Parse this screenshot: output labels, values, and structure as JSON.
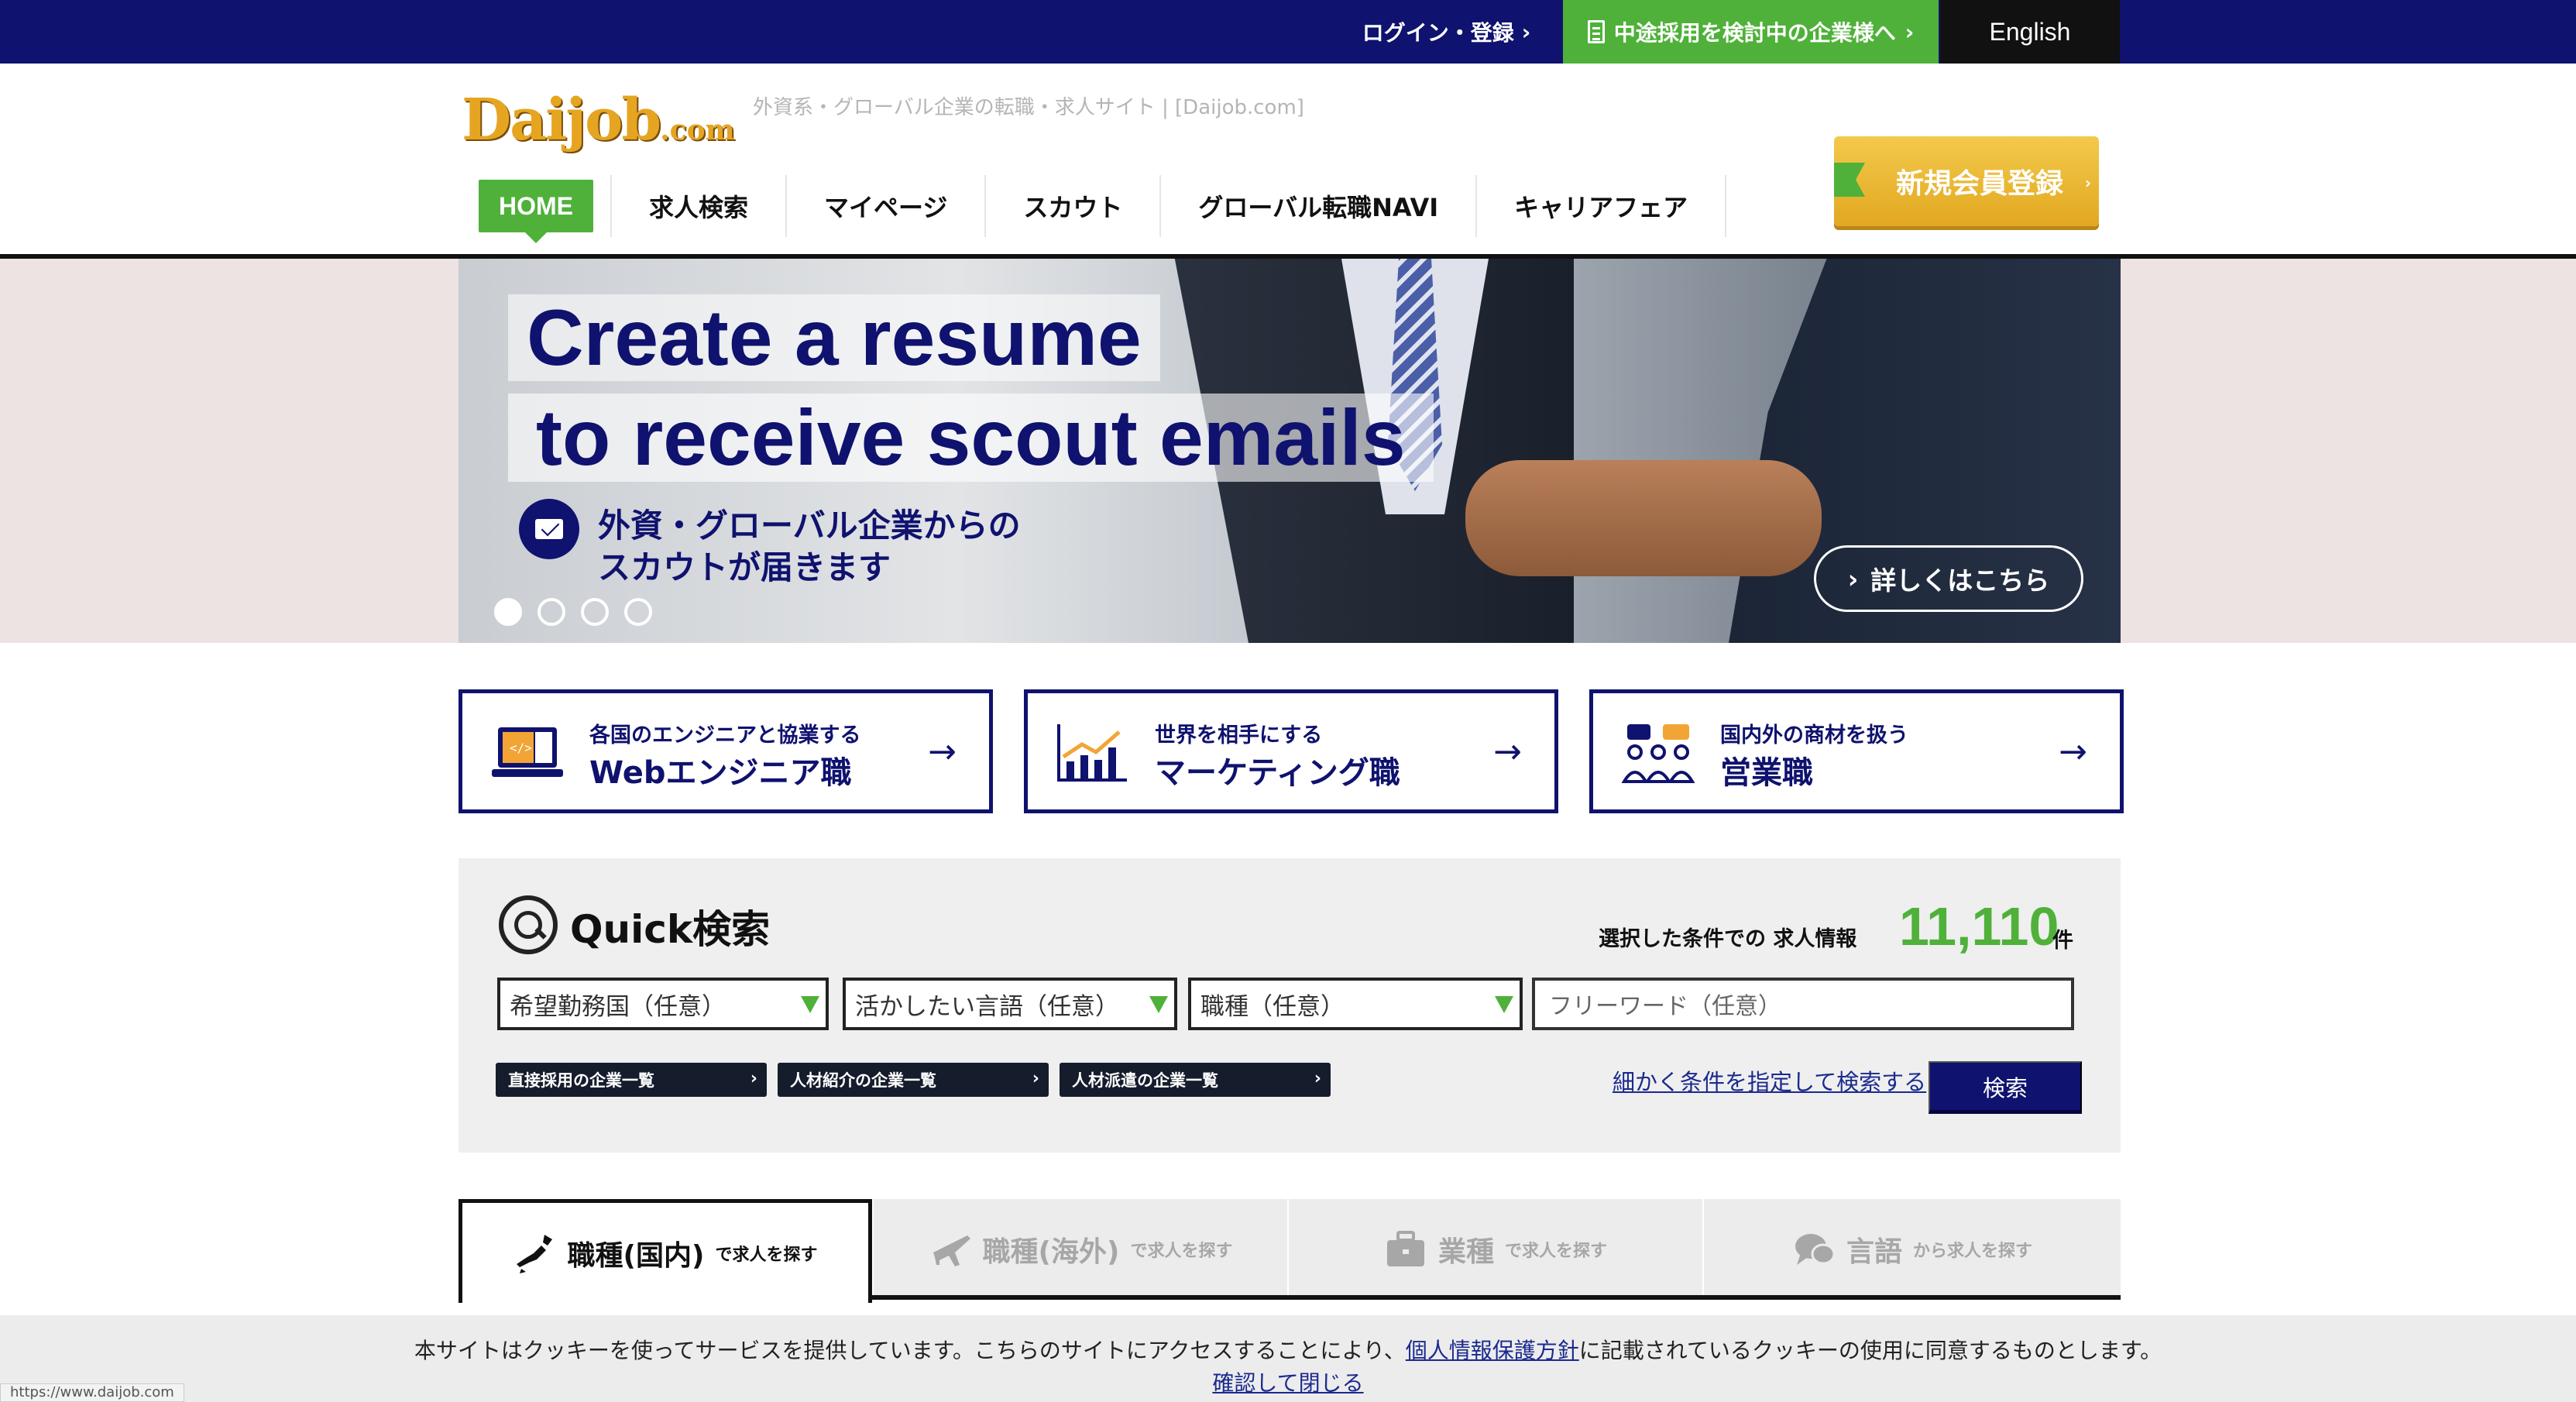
{
  "topbar": {
    "login_label": "ログイン・登録",
    "corporate_label": "中途採用を検討中の企業様へ",
    "english_label": "English"
  },
  "header": {
    "logo_text": "Daijob",
    "logo_suffix": ".com",
    "tagline": "外資系・グローバル企業の転職・求人サイト | [Daijob.com]",
    "register_label": "新規会員登録"
  },
  "nav": {
    "items": [
      "HOME",
      "求人検索",
      "マイページ",
      "スカウト",
      "グローバル転職NAVI",
      "キャリアフェア"
    ]
  },
  "hero": {
    "headline_line1": "Create a resume",
    "headline_line2": "to receive scout emails",
    "sub_line1": "外資・グローバル企業からの",
    "sub_line2": "スカウトが届きます",
    "more_label": "詳しくはこちら",
    "slide_count": 4,
    "active_slide": 1
  },
  "categories": [
    {
      "small": "各国のエンジニアと協業する",
      "big": "Webエンジニア職",
      "icon": "laptop-code-icon"
    },
    {
      "small": "世界を相手にする",
      "big": "マーケティング職",
      "icon": "chart-growth-icon"
    },
    {
      "small": "国内外の商材を扱う",
      "big": "営業職",
      "icon": "team-meeting-icon"
    }
  ],
  "quick_search": {
    "title": "Quick検索",
    "count_label": "選択した条件での 求人情報",
    "count": "11,110",
    "count_unit": "件",
    "selects": [
      "希望勤務国（任意）",
      "活かしたい言語（任意）",
      "職種（任意）"
    ],
    "freeword_placeholder": "フリーワード（任意）",
    "company_links": [
      "直接採用の企業一覧",
      "人材紹介の企業一覧",
      "人材派遣の企業一覧"
    ],
    "detail_link": "細かく条件を指定して検索する",
    "search_button": "検索"
  },
  "tabs": [
    {
      "main": "職種(国内)",
      "sub": "で求人を探す",
      "icon": "japan-map-icon"
    },
    {
      "main": "職種(海外)",
      "sub": "で求人を探す",
      "icon": "airplane-icon"
    },
    {
      "main": "業種",
      "sub": "で求人を探す",
      "icon": "briefcase-icon"
    },
    {
      "main": "言語",
      "sub": "から求人を探す",
      "icon": "speech-bubble-icon"
    }
  ],
  "cookie": {
    "text_before": "本サイトはクッキーを使ってサービスを提供しています。こちらのサイトにアクセスすることにより、",
    "policy_link": "個人情報保護方針",
    "text_after": "に記載されているクッキーの使用に同意するものとします。",
    "close_label": "確認して閉じる"
  },
  "status_url": "https://www.daijob.com",
  "colors": {
    "navy": "#0f126e",
    "green": "#4fb13a",
    "gold": "#e6a521"
  }
}
